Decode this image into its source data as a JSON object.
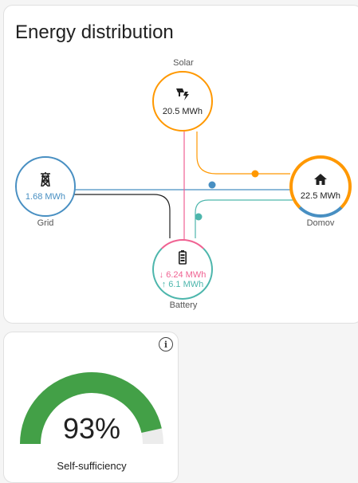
{
  "energy_card": {
    "title": "Energy distribution",
    "solar": {
      "label": "Solar",
      "value": "20.5 MWh",
      "color": "#ff9800",
      "icon": "solar-power-icon"
    },
    "grid": {
      "label": "Grid",
      "value": "1.68 MWh",
      "color": "#488fc2",
      "icon": "transmission-tower-icon"
    },
    "home": {
      "label": "Domov",
      "value": "22.5 MWh",
      "color": "#ff9800",
      "icon": "home-icon"
    },
    "battery": {
      "label": "Battery",
      "value_out": "↓ 6.24 MWh",
      "value_in": "↑ 6.1 MWh",
      "color": "#f06292",
      "color_in": "#4db6ac",
      "icon": "battery-icon"
    }
  },
  "self_sufficiency_card": {
    "value": "93%",
    "fraction": 0.93,
    "label": "Self-sufficiency",
    "gauge_color": "#43a047",
    "icon": "info-icon"
  }
}
